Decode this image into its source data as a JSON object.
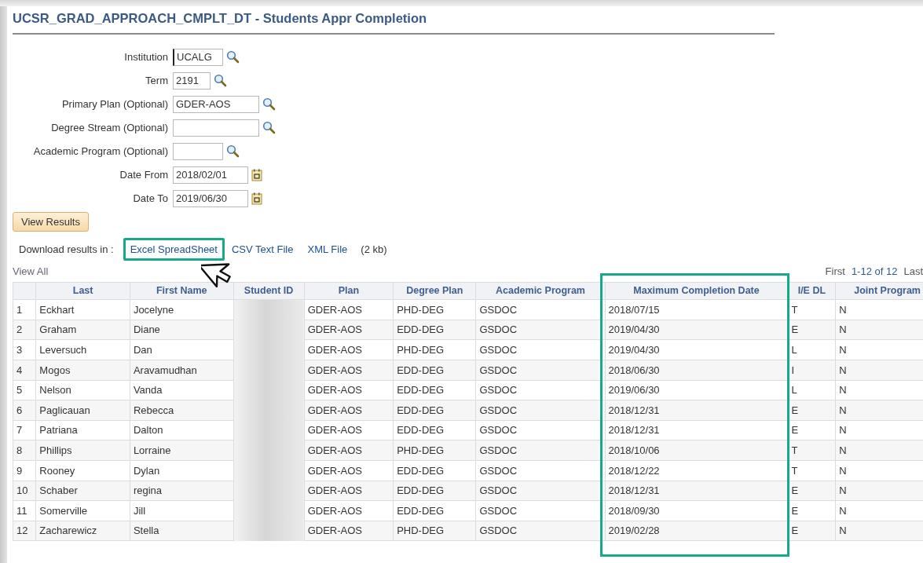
{
  "title": "UCSR_GRAD_APPROACH_CMPLT_DT - Students Appr Completion",
  "fields": [
    {
      "label": "Institution",
      "value": "UCALG",
      "kind": "lookup",
      "focused": true
    },
    {
      "label": "Term",
      "value": "2191",
      "kind": "lookup",
      "focused": false
    },
    {
      "label": "Primary Plan (Optional)",
      "value": "GDER-AOS",
      "kind": "lookup",
      "focused": false
    },
    {
      "label": "Degree Stream (Optional)",
      "kind": "lookup",
      "focused": false
    },
    {
      "label": "Academic Program (Optional)",
      "kind": "lookup",
      "focused": false
    },
    {
      "label": "Date From",
      "value": "2018/02/01",
      "kind": "date",
      "focused": false
    },
    {
      "label": "Date To",
      "value": "2019/06/30",
      "kind": "date",
      "focused": false
    }
  ],
  "button": "View Results",
  "download": {
    "label": "Download results in :",
    "links": [
      {
        "label": "Excel SpreadSheet",
        "highlighted": true
      },
      {
        "label": "CSV Text File",
        "highlighted": false
      },
      {
        "label": "XML File",
        "highlighted": false
      }
    ],
    "size": "(2 kb)"
  },
  "view_all": "View All",
  "pagination": {
    "first": "First",
    "range": "1-12 of 12",
    "last": "Last"
  },
  "table": {
    "columns": [
      {
        "highlighted": false
      },
      {
        "label": "Last",
        "highlighted": false
      },
      {
        "label": "First Name",
        "highlighted": false
      },
      {
        "label": "Student ID",
        "highlighted": false,
        "redacted": true
      },
      {
        "label": "Plan",
        "highlighted": false
      },
      {
        "label": "Degree Plan",
        "highlighted": false
      },
      {
        "label": "Academic Program",
        "highlighted": false
      },
      {
        "label": "Maximum Completion Date",
        "highlighted": true
      },
      {
        "label": "I/E DL",
        "highlighted": false
      },
      {
        "label": "Joint Program",
        "highlighted": false
      }
    ],
    "rows": [
      [
        "1",
        "Eckhart",
        "Jocelyne",
        "",
        "GDER-AOS",
        "PHD-DEG",
        "GSDOC",
        "2018/07/15",
        "T",
        "N"
      ],
      [
        "2",
        "Graham",
        "Diane",
        "",
        "GDER-AOS",
        "EDD-DEG",
        "GSDOC",
        "2019/04/30",
        "E",
        "N"
      ],
      [
        "3",
        "Leversuch",
        "Dan",
        "",
        "GDER-AOS",
        "PHD-DEG",
        "GSDOC",
        "2019/04/30",
        "L",
        "N"
      ],
      [
        "4",
        "Mogos",
        "Aravamudhan",
        "",
        "GDER-AOS",
        "EDD-DEG",
        "GSDOC",
        "2018/06/30",
        "I",
        "N"
      ],
      [
        "5",
        "Nelson",
        "Vanda",
        "",
        "GDER-AOS",
        "EDD-DEG",
        "GSDOC",
        "2019/06/30",
        "L",
        "N"
      ],
      [
        "6",
        "Paglicauan",
        "Rebecca",
        "",
        "GDER-AOS",
        "EDD-DEG",
        "GSDOC",
        "2018/12/31",
        "E",
        "N"
      ],
      [
        "7",
        "Patriana",
        "Dalton",
        "",
        "GDER-AOS",
        "EDD-DEG",
        "GSDOC",
        "2018/12/31",
        "E",
        "N"
      ],
      [
        "8",
        "Phillips",
        "Lorraine",
        "",
        "GDER-AOS",
        "PHD-DEG",
        "GSDOC",
        "2018/10/06",
        "T",
        "N"
      ],
      [
        "9",
        "Rooney",
        "Dylan",
        "",
        "GDER-AOS",
        "EDD-DEG",
        "GSDOC",
        "2018/12/22",
        "T",
        "N"
      ],
      [
        "10",
        "Schaber",
        "regina",
        "",
        "GDER-AOS",
        "EDD-DEG",
        "GSDOC",
        "2018/12/31",
        "E",
        "N"
      ],
      [
        "11",
        "Somerville",
        "Jill",
        "",
        "GDER-AOS",
        "EDD-DEG",
        "GSDOC",
        "2018/09/30",
        "E",
        "N"
      ],
      [
        "12",
        "Zacharewicz",
        "Stella",
        "",
        "GDER-AOS",
        "PHD-DEG",
        "GSDOC",
        "2019/02/28",
        "E",
        "N"
      ]
    ]
  }
}
